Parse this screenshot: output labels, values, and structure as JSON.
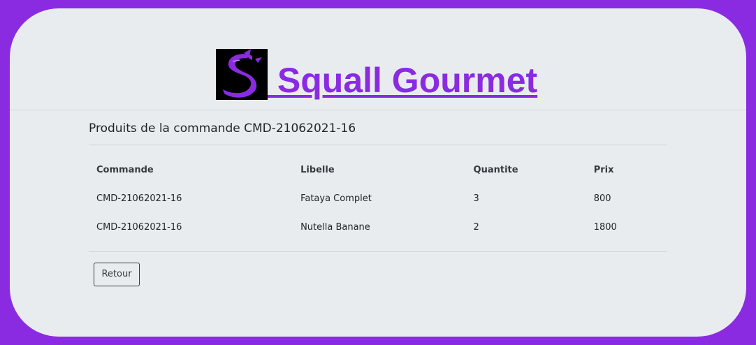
{
  "brand": {
    "title": " Squall Gourmet",
    "logo_icon": "shark-s-logo-icon",
    "accent_color": "#8a2be2"
  },
  "section": {
    "title": "Produits de la commande CMD-21062021-16"
  },
  "table": {
    "headers": [
      "Commande",
      "Libelle",
      "Quantite",
      "Prix"
    ],
    "rows": [
      [
        "CMD-21062021-16",
        "Fataya Complet",
        "3",
        "800"
      ],
      [
        "CMD-21062021-16",
        "Nutella Banane",
        "2",
        "1800"
      ]
    ]
  },
  "actions": {
    "back_label": "Retour"
  }
}
